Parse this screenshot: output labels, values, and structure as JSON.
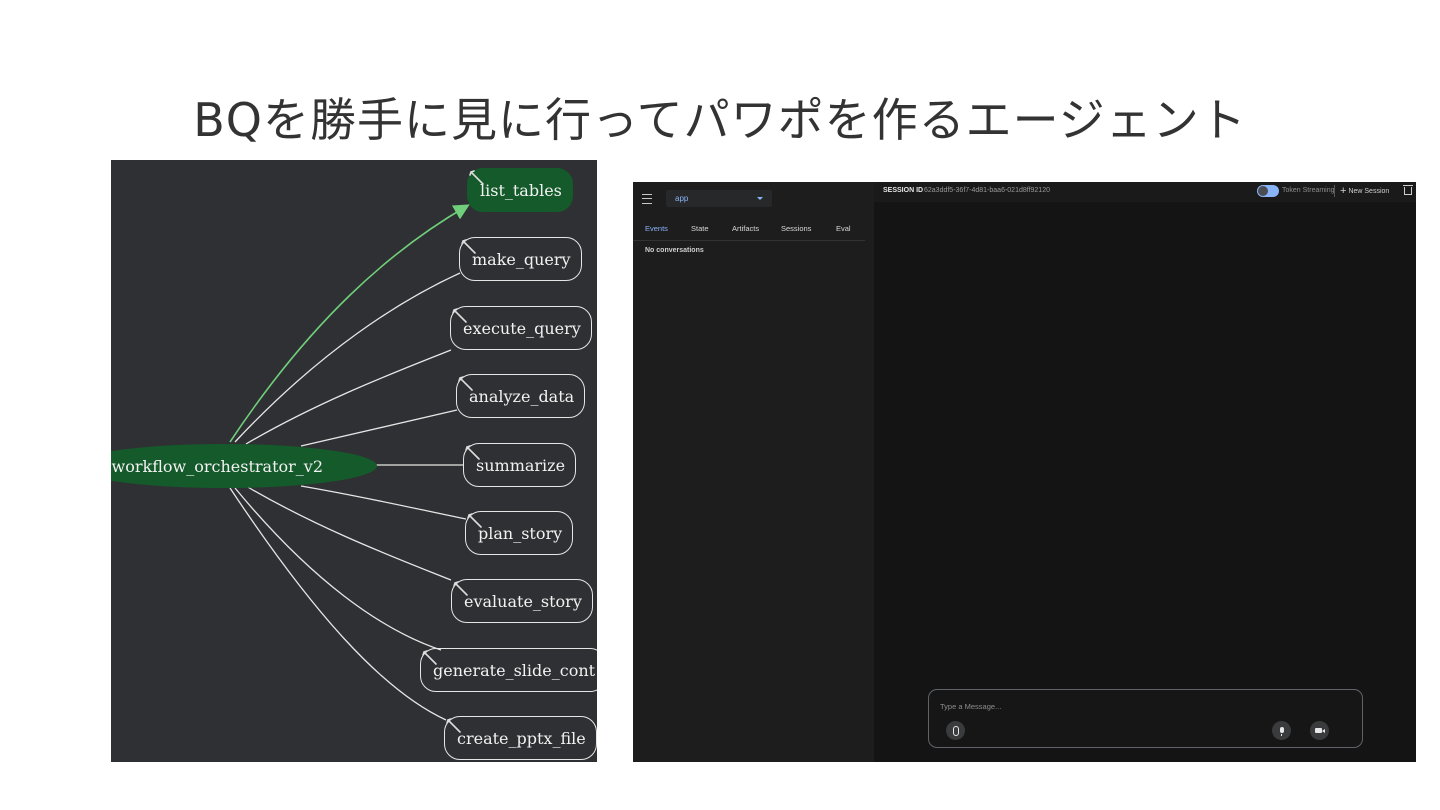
{
  "slide": {
    "title": "BQを勝手に見に行ってパワポを作るエージェント"
  },
  "graph": {
    "root": {
      "label": "workflow_orchestrator_v2",
      "icon": "robot-icon"
    },
    "tools": [
      {
        "label": "list_tables",
        "active": true
      },
      {
        "label": "make_query"
      },
      {
        "label": "execute_query"
      },
      {
        "label": "analyze_data"
      },
      {
        "label": "summarize"
      },
      {
        "label": "plan_story"
      },
      {
        "label": "evaluate_story"
      },
      {
        "label": "generate_slide_cont"
      },
      {
        "label": "create_pptx_file"
      }
    ],
    "colors": {
      "background": "#2f3033",
      "active_node": "#145a2a",
      "active_edge": "#6fcf7a",
      "edge": "#e6e6e6"
    }
  },
  "app": {
    "app_select": "app",
    "tabs": [
      "Events",
      "State",
      "Artifacts",
      "Sessions",
      "Eval"
    ],
    "active_tab": "Events",
    "empty_message": "No conversations",
    "session_label": "SESSION ID",
    "session_id": "62a3ddf5-36f7-4d81-baa6-021d8ff92120",
    "token_streaming_label": "Token Streaming",
    "new_session_label": "New Session",
    "message_placeholder": "Type a Message...",
    "accent_color": "#8ab4f8"
  }
}
